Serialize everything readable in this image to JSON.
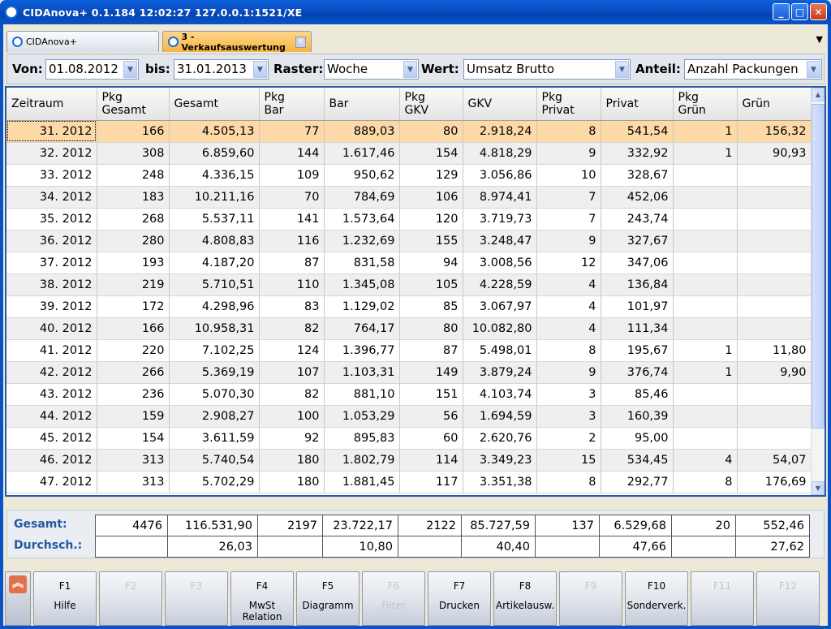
{
  "window": {
    "title": "CIDAnova+  0.1.184  12:02:27  127.0.0.1:1521/XE",
    "buttons": [
      "_",
      "□",
      "✕"
    ]
  },
  "tabs": [
    {
      "label": "CIDAnova+",
      "active": false
    },
    {
      "label": "3 - Verkaufsauswertung",
      "active": true,
      "close": "✕"
    }
  ],
  "menu_arrow": "▼",
  "filters": {
    "von_label": "Von:",
    "von_value": "01.08.2012",
    "bis_label": "bis:",
    "bis_value": "31.01.2013",
    "raster_label": "Raster:",
    "raster_value": "Woche",
    "wert_label": "Wert:",
    "wert_value": "Umsatz Brutto",
    "anteil_label": "Anteil:",
    "anteil_value": "Anzahl Packungen",
    "dropdown_glyph": "▼"
  },
  "grid": {
    "columns": [
      {
        "line1": "Zeitraum",
        "line2": ""
      },
      {
        "line1": "Pkg",
        "line2": "Gesamt"
      },
      {
        "line1": "Gesamt",
        "line2": ""
      },
      {
        "line1": "Pkg",
        "line2": "Bar"
      },
      {
        "line1": "Bar",
        "line2": ""
      },
      {
        "line1": "Pkg",
        "line2": "GKV"
      },
      {
        "line1": "GKV",
        "line2": ""
      },
      {
        "line1": "Pkg",
        "line2": "Privat"
      },
      {
        "line1": "Privat",
        "line2": ""
      },
      {
        "line1": "Pkg",
        "line2": "Grün"
      },
      {
        "line1": "Grün",
        "line2": ""
      }
    ],
    "rows": [
      [
        "31. 2012",
        "166",
        "4.505,13",
        "77",
        "889,03",
        "80",
        "2.918,24",
        "8",
        "541,54",
        "1",
        "156,32"
      ],
      [
        "32. 2012",
        "308",
        "6.859,60",
        "144",
        "1.617,46",
        "154",
        "4.818,29",
        "9",
        "332,92",
        "1",
        "90,93"
      ],
      [
        "33. 2012",
        "248",
        "4.336,15",
        "109",
        "950,62",
        "129",
        "3.056,86",
        "10",
        "328,67",
        "",
        ""
      ],
      [
        "34. 2012",
        "183",
        "10.211,16",
        "70",
        "784,69",
        "106",
        "8.974,41",
        "7",
        "452,06",
        "",
        ""
      ],
      [
        "35. 2012",
        "268",
        "5.537,11",
        "141",
        "1.573,64",
        "120",
        "3.719,73",
        "7",
        "243,74",
        "",
        ""
      ],
      [
        "36. 2012",
        "280",
        "4.808,83",
        "116",
        "1.232,69",
        "155",
        "3.248,47",
        "9",
        "327,67",
        "",
        ""
      ],
      [
        "37. 2012",
        "193",
        "4.187,20",
        "87",
        "831,58",
        "94",
        "3.008,56",
        "12",
        "347,06",
        "",
        ""
      ],
      [
        "38. 2012",
        "219",
        "5.710,51",
        "110",
        "1.345,08",
        "105",
        "4.228,59",
        "4",
        "136,84",
        "",
        ""
      ],
      [
        "39. 2012",
        "172",
        "4.298,96",
        "83",
        "1.129,02",
        "85",
        "3.067,97",
        "4",
        "101,97",
        "",
        ""
      ],
      [
        "40. 2012",
        "166",
        "10.958,31",
        "82",
        "764,17",
        "80",
        "10.082,80",
        "4",
        "111,34",
        "",
        ""
      ],
      [
        "41. 2012",
        "220",
        "7.102,25",
        "124",
        "1.396,77",
        "87",
        "5.498,01",
        "8",
        "195,67",
        "1",
        "11,80"
      ],
      [
        "42. 2012",
        "266",
        "5.369,19",
        "107",
        "1.103,31",
        "149",
        "3.879,24",
        "9",
        "376,74",
        "1",
        "9,90"
      ],
      [
        "43. 2012",
        "236",
        "5.070,30",
        "82",
        "881,10",
        "151",
        "4.103,74",
        "3",
        "85,46",
        "",
        ""
      ],
      [
        "44. 2012",
        "159",
        "2.908,27",
        "100",
        "1.053,29",
        "56",
        "1.694,59",
        "3",
        "160,39",
        "",
        ""
      ],
      [
        "45. 2012",
        "154",
        "3.611,59",
        "92",
        "895,83",
        "60",
        "2.620,76",
        "2",
        "95,00",
        "",
        ""
      ],
      [
        "46. 2012",
        "313",
        "5.740,54",
        "180",
        "1.802,79",
        "114",
        "3.349,23",
        "15",
        "534,45",
        "4",
        "54,07"
      ],
      [
        "47. 2012",
        "313",
        "5.702,29",
        "180",
        "1.881,45",
        "117",
        "3.351,38",
        "8",
        "292,77",
        "8",
        "176,69"
      ]
    ],
    "selected_row": 0
  },
  "totals": {
    "gesamt_label": "Gesamt:",
    "durchschnitt_label": "Durchsch.:",
    "gesamt": [
      "4476",
      "116.531,90",
      "2197",
      "23.722,17",
      "2122",
      "85.727,59",
      "137",
      "6.529,68",
      "20",
      "552,46"
    ],
    "durchschnitt": [
      "",
      "26,03",
      "",
      "10,80",
      "",
      "40,40",
      "",
      "47,66",
      "",
      "27,62"
    ]
  },
  "fkeys": {
    "expand_glyph": "︽",
    "keys": [
      {
        "key": "F1",
        "label": "Hilfe",
        "enabled": true
      },
      {
        "key": "F2",
        "label": "",
        "enabled": false
      },
      {
        "key": "F3",
        "label": "",
        "enabled": false
      },
      {
        "key": "F4",
        "label": "MwSt\nRelation",
        "enabled": true
      },
      {
        "key": "F5",
        "label": "Diagramm",
        "enabled": true
      },
      {
        "key": "F6",
        "label": "Filter",
        "enabled": false
      },
      {
        "key": "F7",
        "label": "Drucken",
        "enabled": true
      },
      {
        "key": "F8",
        "label": "Artikelausw.",
        "enabled": true
      },
      {
        "key": "F9",
        "label": "",
        "enabled": false
      },
      {
        "key": "F10",
        "label": "Sonderverk.",
        "enabled": true
      },
      {
        "key": "F11",
        "label": "",
        "enabled": false
      },
      {
        "key": "F12",
        "label": "",
        "enabled": false
      }
    ]
  }
}
